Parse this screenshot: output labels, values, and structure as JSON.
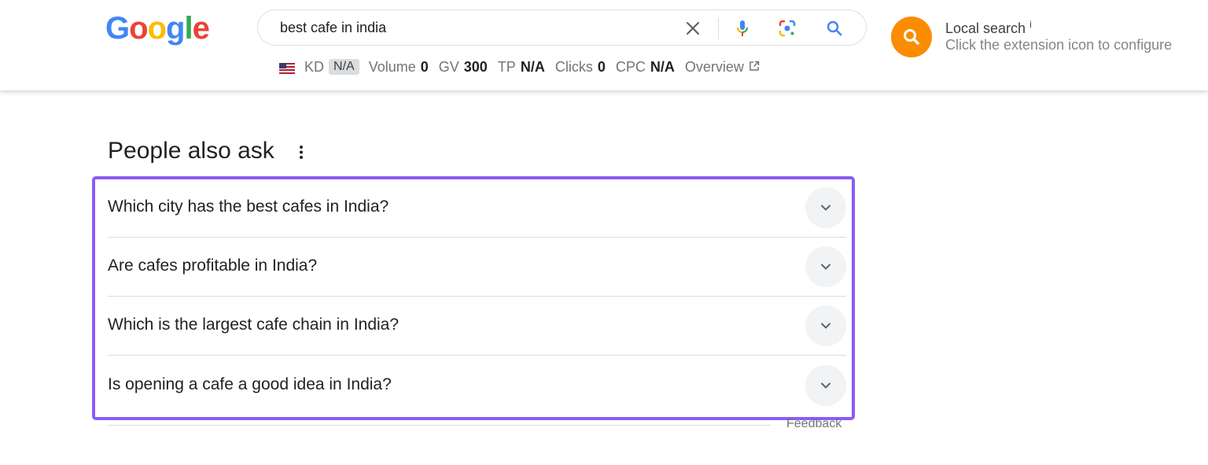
{
  "logo": {
    "letters": [
      "G",
      "o",
      "o",
      "g",
      "l",
      "e"
    ],
    "colors": [
      "#4285f4",
      "#ea4335",
      "#fbbc05",
      "#4285f4",
      "#34a853",
      "#ea4335"
    ]
  },
  "search": {
    "query": "best cafe in india"
  },
  "icons": {
    "clear": "close-icon",
    "voice": "microphone-icon",
    "lens": "lens-icon",
    "search": "search-icon"
  },
  "seo": {
    "kd_label": "KD",
    "kd_value": "N/A",
    "volume_label": "Volume",
    "volume_value": "0",
    "gv_label": "GV",
    "gv_value": "300",
    "tp_label": "TP",
    "tp_value": "N/A",
    "clicks_label": "Clicks",
    "clicks_value": "0",
    "cpc_label": "CPC",
    "cpc_value": "N/A",
    "overview_label": "Overview"
  },
  "extension": {
    "title": "Local search",
    "info": "i",
    "subtitle": "Click the extension icon to configure",
    "color": "#fb8c00"
  },
  "paa": {
    "title": "People also ask",
    "highlight_color": "#8b5cf6",
    "questions": [
      "Which city has the best cafes in India?",
      "Are cafes profitable in India?",
      "Which is the largest cafe chain in India?",
      "Is opening a cafe a good idea in India?"
    ],
    "feedback": "Feedback"
  }
}
